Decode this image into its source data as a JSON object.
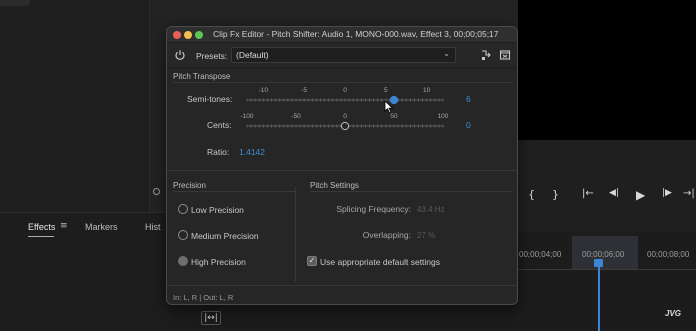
{
  "background_app": {
    "panel_tabs": [
      {
        "label": "Effects",
        "active": true
      },
      {
        "label": "Markers",
        "active": false
      },
      {
        "label": "Hist",
        "active": false
      }
    ],
    "transport_buttons": [
      {
        "icon": "mark-in-icon",
        "glyph": "{"
      },
      {
        "icon": "mark-out-icon",
        "glyph": "}"
      },
      {
        "icon": "go-to-in-icon",
        "glyph": "|←"
      },
      {
        "icon": "step-back-icon",
        "glyph": "◀|"
      },
      {
        "icon": "play-icon",
        "glyph": "▶"
      },
      {
        "icon": "step-forward-icon",
        "glyph": "|▶"
      },
      {
        "icon": "go-to-out-icon",
        "glyph": "→|"
      }
    ],
    "timeline_times": [
      "00;00;04;00",
      "00;00;06;00",
      "00;00;08;00"
    ],
    "watermark": "JVG",
    "bottom_tool_glyph": "|↔|",
    "accent_color": "#3b86d4"
  },
  "dialog": {
    "title": "Clip Fx Editor - Pitch Shifter: Audio 1, MONO-000.wav, Effect 3, 00;00;05;17",
    "presets_label": "Presets:",
    "presets_value": "(Default)",
    "pitch_transpose": {
      "section_label": "Pitch Transpose",
      "semitones": {
        "label": "Semi-tones:",
        "value": "6",
        "min": -12,
        "max": 12,
        "current": 6,
        "tick_labels": [
          "-10",
          "-5",
          "0",
          "5",
          "10"
        ]
      },
      "cents": {
        "label": "Cents:",
        "value": "0",
        "min": -100,
        "max": 100,
        "current": 0,
        "tick_labels": [
          "-100",
          "-50",
          "0",
          "50",
          "100"
        ]
      },
      "ratio": {
        "label": "Ratio:",
        "value": "1.4142"
      }
    },
    "precision": {
      "section_label": "Precision",
      "options": [
        {
          "label": "Low Precision",
          "selected": false
        },
        {
          "label": "Medium Precision",
          "selected": false
        },
        {
          "label": "High Precision",
          "selected": true
        }
      ]
    },
    "pitch_settings": {
      "section_label": "Pitch Settings",
      "splicing_label": "Splicing Frequency:",
      "splicing_value": "43.4 Hz",
      "overlapping_label": "Overlapping:",
      "overlapping_value": "27 %",
      "checkbox_label": "Use appropriate default settings",
      "checkbox_checked": true
    },
    "io_text": "In: L, R | Out: L, R"
  }
}
